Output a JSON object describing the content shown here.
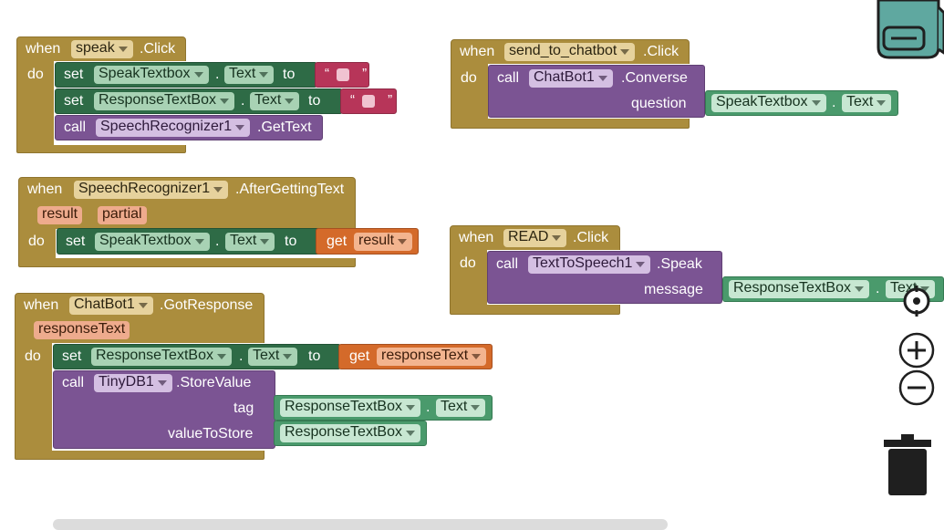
{
  "kw": {
    "when": "when",
    "do": "do",
    "set": "set",
    "call": "call",
    "to": "to",
    "get": "get",
    "dot": "."
  },
  "quote": "“ ”",
  "b1": {
    "component": "speak",
    "event": ".Click",
    "set1_comp": "SpeakTextbox",
    "set1_prop": "Text",
    "set2_comp": "ResponseTextBox",
    "set2_prop": "Text",
    "call_comp": "SpeechRecognizer1",
    "call_method": ".GetText"
  },
  "b2": {
    "component": "send_to_chatbot",
    "event": ".Click",
    "call_comp": "ChatBot1",
    "call_method": ".Converse",
    "arg_label": "question",
    "arg_comp": "SpeakTextbox",
    "arg_prop": "Text"
  },
  "b3": {
    "component": "SpeechRecognizer1",
    "event": ".AfterGettingText",
    "params": [
      "result",
      "partial"
    ],
    "set_comp": "SpeakTextbox",
    "set_prop": "Text",
    "get_var": "result"
  },
  "b4": {
    "component": "READ",
    "event": ".Click",
    "call_comp": "TextToSpeech1",
    "call_method": ".Speak",
    "arg_label": "message",
    "arg_comp": "ResponseTextBox",
    "arg_prop": "Text"
  },
  "b5": {
    "component": "ChatBot1",
    "event": ".GotResponse",
    "params": [
      "responseText"
    ],
    "set_comp": "ResponseTextBox",
    "set_prop": "Text",
    "get_var": "responseText",
    "call_comp": "TinyDB1",
    "call_method": ".StoreValue",
    "arg1_label": "tag",
    "arg1_comp": "ResponseTextBox",
    "arg1_prop": "Text",
    "arg2_label": "valueToStore",
    "arg2_comp": "ResponseTextBox"
  },
  "icons": {
    "backpack": "backpack-icon",
    "recenter": "recenter-icon",
    "zoom_in": "zoom-in-icon",
    "zoom_out": "zoom-out-icon",
    "trash": "trash-icon"
  },
  "colors": {
    "event": "#ab8d3d",
    "set": "#2e6b46",
    "procedure": "#7b5493",
    "component": "#4a9a6c",
    "variable": "#d46a2a",
    "text": "#b73559"
  }
}
